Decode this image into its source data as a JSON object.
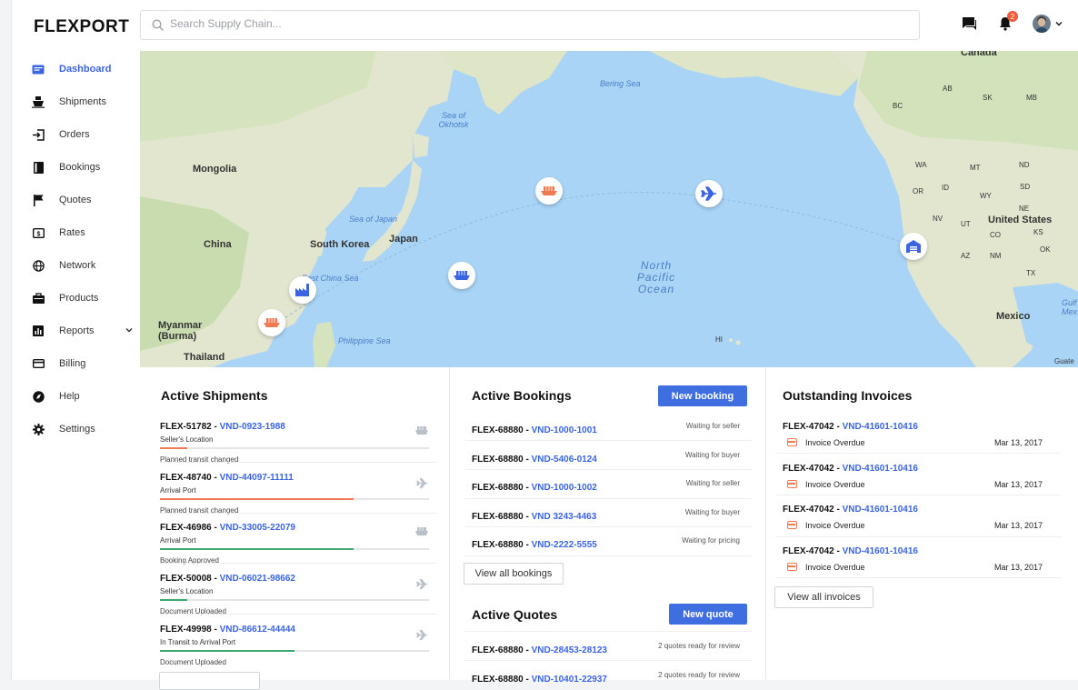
{
  "header": {
    "logo": "FLEXPORT",
    "search_placeholder": "Search Supply Chain...",
    "notifications_count": "2"
  },
  "sidebar": {
    "items": [
      {
        "label": "Dashboard",
        "icon": "dashboard-icon"
      },
      {
        "label": "Shipments",
        "icon": "ship-icon"
      },
      {
        "label": "Orders",
        "icon": "orders-icon"
      },
      {
        "label": "Bookings",
        "icon": "bookings-icon"
      },
      {
        "label": "Quotes",
        "icon": "flag-icon"
      },
      {
        "label": "Rates",
        "icon": "rates-icon"
      },
      {
        "label": "Network",
        "icon": "globe-icon"
      },
      {
        "label": "Products",
        "icon": "products-icon"
      },
      {
        "label": "Reports",
        "icon": "reports-icon"
      },
      {
        "label": "Billing",
        "icon": "billing-icon"
      },
      {
        "label": "Help",
        "icon": "help-icon"
      },
      {
        "label": "Settings",
        "icon": "gear-icon"
      }
    ]
  },
  "map": {
    "labels": {
      "canada": "Canada",
      "bering_sea": "Bering Sea",
      "sea_of_okhotsk": "Sea of Okhotsk",
      "mongolia": "Mongolia",
      "china": "China",
      "south_korea": "South Korea",
      "japan": "Japan",
      "sea_of_japan": "Sea of Japan",
      "east_china_sea": "East China Sea",
      "myanmar": "Myanmar (Burma)",
      "thailand": "Thailand",
      "philippine_sea": "Philippine Sea",
      "north_pacific": "North Pacific Ocean",
      "united_states": "United States",
      "mexico": "Mexico",
      "gulf": "Gulf Mex",
      "hi": "HI",
      "ab": "AB",
      "bc": "BC",
      "mb": "MB",
      "sk": "SK",
      "wa": "WA",
      "or": "OR",
      "mt": "MT",
      "nd": "ND",
      "id": "ID",
      "wy": "WY",
      "sd": "SD",
      "nv": "NV",
      "ut": "UT",
      "co": "CO",
      "ca": "CA",
      "az": "AZ",
      "nm": "NM",
      "tx": "TX",
      "ne": "NE",
      "ks": "KS",
      "ok": "OK",
      "guate": "Guate"
    }
  },
  "colors": {
    "accent": "#3f6ee0",
    "link": "#3b64e3",
    "orange": "#f07a52",
    "green": "#3fa872",
    "ocean": "#a9d4f5",
    "land": "#e7e7d2"
  },
  "shipments": {
    "title": "Active Shipments",
    "items": [
      {
        "id": "FLEX-51782",
        "vnd": "VND-0923-1988",
        "location": "Seller's Location",
        "status": "Planned transit changed",
        "progress": 0.1,
        "color": "orange",
        "mode": "ship-icon"
      },
      {
        "id": "FLEX-48740",
        "vnd": "VND-44097-11111",
        "location": "Arrival Port",
        "status": "Planned transit changed",
        "progress": 0.72,
        "color": "orange",
        "mode": "plane-icon"
      },
      {
        "id": "FLEX-46986",
        "vnd": "VND-33005-22079",
        "location": "Arrival Port",
        "status": "Booking Approved",
        "progress": 0.72,
        "color": "green",
        "mode": "ship-icon"
      },
      {
        "id": "FLEX-50008",
        "vnd": "VND-06021-98662",
        "location": "Seller's Location",
        "status": "Document Uploaded",
        "progress": 0.1,
        "color": "green",
        "mode": "plane-icon"
      },
      {
        "id": "FLEX-49998",
        "vnd": "VND-86612-44444",
        "location": "In Transit to Arrival Port",
        "status": "Document Uploaded",
        "progress": 0.5,
        "color": "green",
        "mode": "plane-icon"
      }
    ]
  },
  "bookings": {
    "title": "Active Bookings",
    "new_label": "New booking",
    "view_all": "View all bookings",
    "items": [
      {
        "id": "FLEX-68880",
        "vnd": "VND-1000-1001",
        "status": "Waiting for seller"
      },
      {
        "id": "FLEX-68880",
        "vnd": "VND-5406-0124",
        "status": "Waiting for buyer"
      },
      {
        "id": "FLEX-68880",
        "vnd": "VND-1000-1002",
        "status": "Waiting for seller"
      },
      {
        "id": "FLEX-68880",
        "vnd": "VND 3243-4463",
        "status": "Waiting for buyer"
      },
      {
        "id": "FLEX-68880",
        "vnd": "VND-2222-5555",
        "status": "Waiting for pricing"
      }
    ]
  },
  "quotes": {
    "title": "Active Quotes",
    "new_label": "New quote",
    "items": [
      {
        "id": "FLEX-68880",
        "vnd": "VND-28453-28123",
        "status": "2 quotes ready for review"
      },
      {
        "id": "FLEX-68880",
        "vnd": "VND-10401-22937",
        "status": "2 quotes ready for review"
      }
    ]
  },
  "invoices": {
    "title": "Outstanding Invoices",
    "view_all": "View all invoices",
    "items": [
      {
        "id": "FLEX-47042",
        "vnd": "VND-41601-10416",
        "status": "Invoice Overdue",
        "date": "Mar 13, 2017"
      },
      {
        "id": "FLEX-47042",
        "vnd": "VND-41601-10416",
        "status": "Invoice Overdue",
        "date": "Mar 13, 2017"
      },
      {
        "id": "FLEX-47042",
        "vnd": "VND-41601-10416",
        "status": "Invoice Overdue",
        "date": "Mar 13, 2017"
      },
      {
        "id": "FLEX-47042",
        "vnd": "VND-41601-10416",
        "status": "Invoice Overdue",
        "date": "Mar 13, 2017"
      }
    ]
  }
}
